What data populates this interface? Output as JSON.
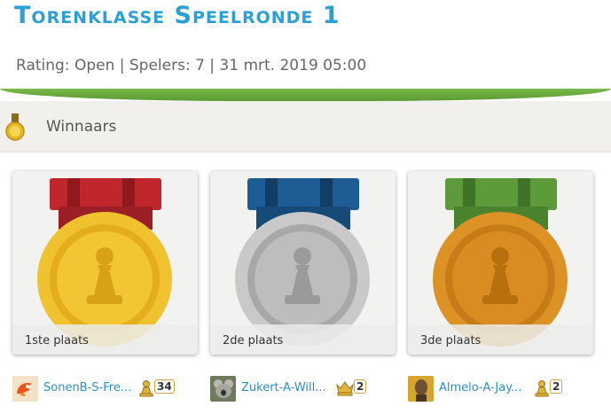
{
  "page": {
    "title": "Torenklasse Speelronde 1",
    "subtitle": "Rating: Open | Spelers: 7 | 31 mrt. 2019 05:00"
  },
  "section": {
    "title": "Winnaars",
    "icon": "medal-icon"
  },
  "placements": [
    {
      "label": "1ste plaats",
      "medal": "gold",
      "ribbon_color": "#c0272d",
      "medal_color": "#f0c230"
    },
    {
      "label": "2de plaats",
      "medal": "silver",
      "ribbon_color": "#1d5c94",
      "medal_color": "#c4c4c4"
    },
    {
      "label": "3de plaats",
      "medal": "bronze",
      "ribbon_color": "#5c9a3a",
      "medal_color": "#d88d22"
    }
  ],
  "winners": [
    {
      "name": "SonenB-S-Fre...",
      "trophy_count": "34",
      "trophy_icon": "pawn-trophy-icon",
      "avatar": "dragon-avatar"
    },
    {
      "name": "Zukert-A-Will...",
      "trophy_count": "2",
      "trophy_icon": "queen-trophy-icon",
      "avatar": "koala-avatar"
    },
    {
      "name": "Almelo-A-Jay...",
      "trophy_count": "2",
      "trophy_icon": "pawn-trophy-icon",
      "avatar": "person-avatar"
    }
  ]
}
